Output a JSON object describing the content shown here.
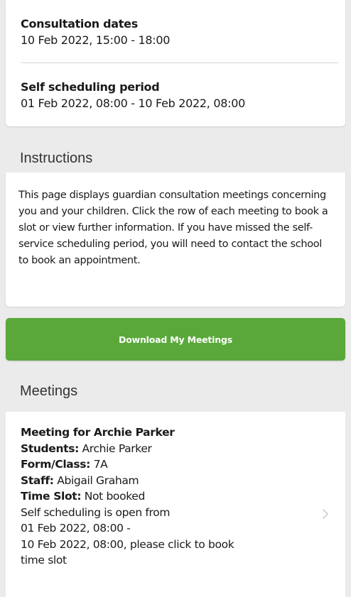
{
  "consultation": {
    "dates_label": "Consultation dates",
    "dates_value": "10 Feb 2022, 15:00 - 18:00",
    "period_label": "Self scheduling period",
    "period_value": "01 Feb 2022, 08:00 - 10 Feb 2022, 08:00"
  },
  "instructions": {
    "header": "Instructions",
    "text": "This page displays guardian consultation meetings concerning you and your children. Click the row of each meeting to book a slot or view further information. If you have missed the self-service scheduling period, you will need to contact the school to book an appointment."
  },
  "download_button": {
    "label": "Download My Meetings",
    "color": "#5aa83a"
  },
  "meetings": {
    "header": "Meetings",
    "items": [
      {
        "title": "Meeting for Archie Parker",
        "students_label": "Students:",
        "students_value": " Archie Parker",
        "form_label": "Form/Class:",
        "form_value": " 7A",
        "staff_label": "Staff:",
        "staff_value": " Abigail Graham",
        "slot_label": "Time Slot:",
        "slot_value": " Not booked",
        "note_line1": "Self scheduling is open from",
        "note_line2": "01 Feb 2022, 08:00 -",
        "note_line3": "10 Feb 2022, 08:00, please click to book",
        "note_line4": "time slot",
        "chevron_icon": "chevron-right-icon"
      }
    ]
  }
}
